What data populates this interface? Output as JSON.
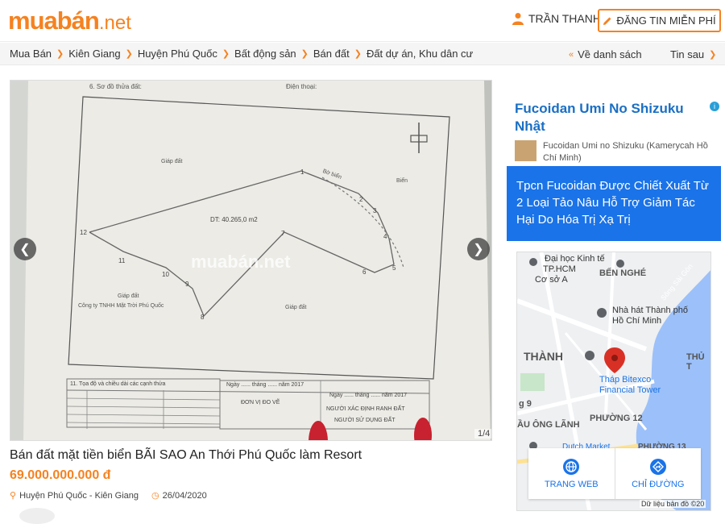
{
  "header": {
    "logo_main": "muabán",
    "logo_tld": ".net",
    "user_name": "TRẦN THANH",
    "post_button": "ĐĂNG TIN MIỄN PHÍ"
  },
  "breadcrumb": {
    "items": [
      "Mua Bán",
      "Kiên Giang",
      "Huyện Phú Quốc",
      "Bất động sản",
      "Bán đất",
      "Đất dự án, Khu dân cư"
    ],
    "back_label": "Về danh sách",
    "next_label": "Tin sau"
  },
  "gallery": {
    "counter": "1/4",
    "watermark": "muabán.net",
    "doc_heading": "6. Sơ đồ thửa đất:",
    "doc_phone": "Điện thoại:",
    "label_area": "DT: 40.265,0 m2",
    "label_giap_dat_1": "Giáp đất",
    "label_giap_dat_2": "Giáp đất",
    "label_giap_dat_3": "Giáp đất",
    "label_company": "Công ty TNHH Mặt Trời Phú Quốc",
    "label_bien": "Biển",
    "label_bo_bien": "Bờ biển",
    "table_heading": "11. Tọa độ và chiều dài các cạnh thửa",
    "sign_date_1": "Ngày ...... tháng ...... năm 2017",
    "sign_unit": "ĐƠN VỊ ĐO VẼ",
    "sign_date_2": "Ngày ...... tháng ...... năm 2017",
    "sign_person": "NGƯỜI XÁC ĐỊNH RANH ĐẤT",
    "sign_user": "NGƯỜI SỬ DỤNG ĐẤT"
  },
  "listing": {
    "title": "Bán đất mặt tiền biển BÃI SAO An Thới Phú Quốc làm Resort",
    "price": "69.000.000.000 đ",
    "location": "Huyện Phú Quốc - Kiên Giang",
    "date": "26/04/2020"
  },
  "ad": {
    "title": "Fucoidan Umi No Shizuku Nhật",
    "subtitle": "Fucoidan Umi no Shizuku (Kamerycah Hồ Chí Minh)",
    "body": "Tpcn Fucoidan Được Chiết Xuất Từ 2 Loại Tảo Nâu Hỗ Trợ Giảm Tác Hại Do Hóa Trị Xạ Trị",
    "info_icon": "i"
  },
  "map": {
    "labels": {
      "kinh_te": "Đại học Kinh tế",
      "tp_hcm": "TP.HCM",
      "co_so_a": "Cơ sở A",
      "ben_nghe": "BẾN NGHÉ",
      "song_sai_gon": "Sông Sài Gòn",
      "nha_hat": "Nhà hát Thành phố Hồ Chí Minh",
      "thanh": "THÀNH",
      "thu_t": "THỦ T",
      "bitexco": "Tháp Bitexco Financial Tower",
      "phuong_9": "g 9",
      "phuong_12": "PHƯỜNG 12",
      "ong_lanh": "ẦU ÔNG LÃNH",
      "market": "Dutch Market",
      "phuong_13": "PHƯỜNG 13"
    },
    "website_label": "TRANG WEB",
    "directions_label": "CHỈ ĐƯỜNG",
    "credit": "Dữ liệu bản đồ ©20"
  },
  "colors": {
    "brand": "#f58220",
    "link_blue": "#1a73e8"
  }
}
